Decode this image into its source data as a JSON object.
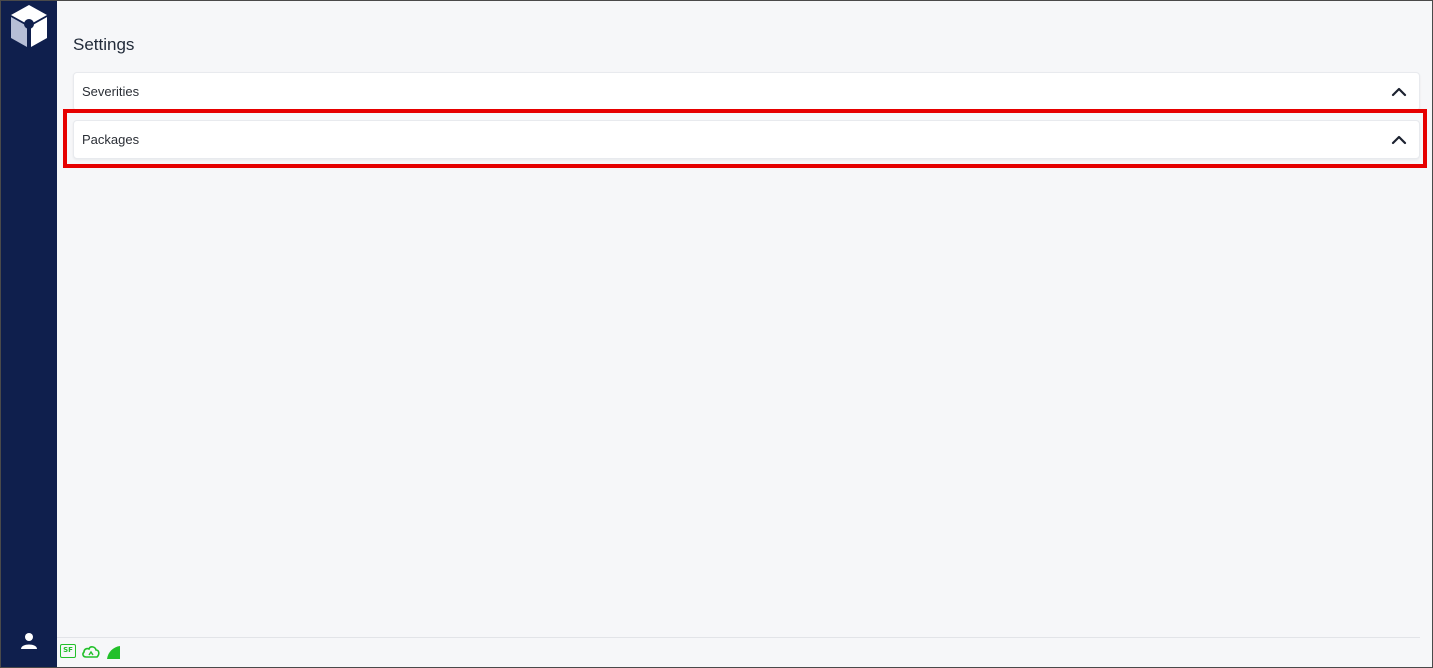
{
  "app": {
    "page_title": "Settings"
  },
  "sidebar": {
    "logo_icon": "cube-logo-icon",
    "user_icon": "user-icon"
  },
  "accordion": {
    "items": [
      {
        "label": "Severities",
        "icon": "chevron-up-icon",
        "expanded": true
      },
      {
        "label": "Packages",
        "icon": "chevron-up-icon",
        "expanded": true
      }
    ]
  },
  "status_bar": {
    "sf_badge": "SF",
    "cloud_icon": "cloud-sync-icon",
    "signal_icon": "signal-icon"
  },
  "colors": {
    "sidebar_bg": "#0f1f4d",
    "highlight": "#e60000",
    "status_green": "#22c02a"
  }
}
